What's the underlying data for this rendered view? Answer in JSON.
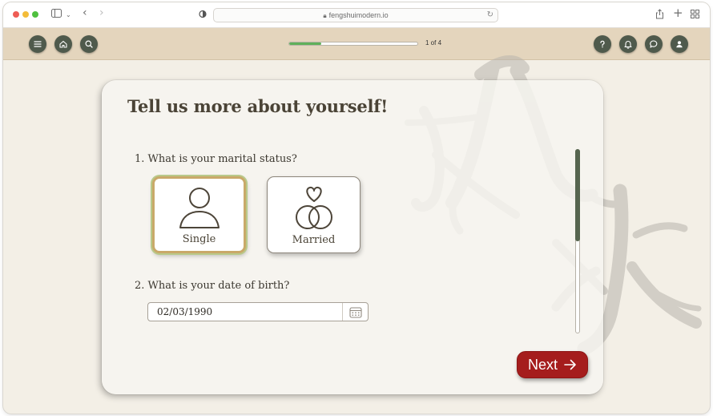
{
  "browser": {
    "url": "fengshuimodern.io"
  },
  "appbar": {
    "progress_label": "1 of 4",
    "progress_fraction": 0.25,
    "left_buttons": [
      "menu-icon",
      "home-icon",
      "search-icon"
    ],
    "right_buttons": [
      "help-icon",
      "bell-icon",
      "chat-icon",
      "user-icon"
    ]
  },
  "form": {
    "title": "Tell us more about yourself!",
    "question1": "1. What is your marital status?",
    "options": [
      {
        "label": "Single",
        "icon": "person-icon",
        "selected": true
      },
      {
        "label": "Married",
        "icon": "rings-heart-icon",
        "selected": false
      }
    ],
    "question2": "2. What is your date of birth?",
    "date_value": "02/03/1990",
    "next_label": "Next"
  },
  "colors": {
    "header_bg": "#e4d5bd",
    "button_dark": "#4f5a4c",
    "accent_red": "#a51d1d",
    "progress_green": "#5fb05a",
    "selected_border": "#c9a969"
  }
}
